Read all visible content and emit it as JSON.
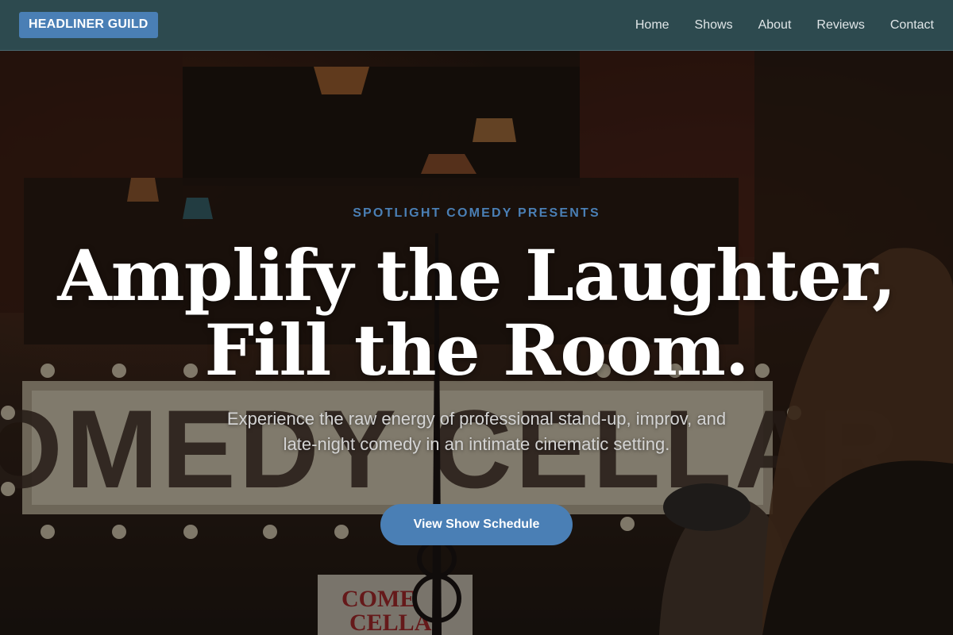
{
  "nav": {
    "brand": "HEADLINER GUILD",
    "links": [
      "Home",
      "Shows",
      "About",
      "Reviews",
      "Contact"
    ]
  },
  "hero": {
    "eyebrow": "SPOTLIGHT COMEDY PRESENTS",
    "headline_line1": "Amplify the Laughter,",
    "headline_line2": "Fill the Room.",
    "subhead": "Experience the raw energy of professional stand-up, improv, and late-night comedy in an intimate cinematic setting.",
    "cta_label": "View Show Schedule",
    "background": {
      "marquee_text": "COMEDY CELLAR",
      "sign_text_1": "COME",
      "sign_text_2": "CELLA"
    }
  },
  "colors": {
    "nav_bg": "#2d4a4f",
    "accent": "#4a7fb5",
    "heading": "#ffffff",
    "body_text": "#d4d4d4"
  }
}
